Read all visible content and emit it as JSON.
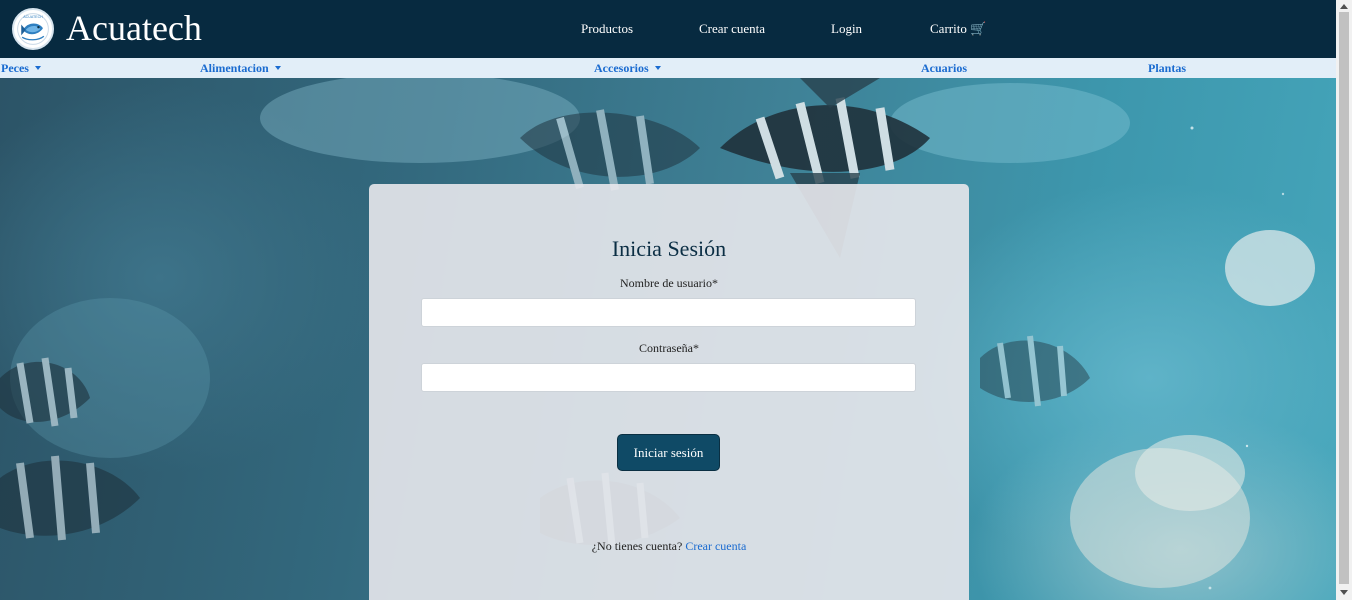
{
  "header": {
    "brand": "Acuatech",
    "logo_text": "ACUATECH",
    "nav": [
      {
        "label": "Productos"
      },
      {
        "label": "Crear cuenta"
      },
      {
        "label": "Login"
      },
      {
        "label": "Carrito 🛒"
      }
    ]
  },
  "categories": [
    {
      "label": "Peces",
      "dropdown": true
    },
    {
      "label": "Alimentacion",
      "dropdown": true
    },
    {
      "label": "Accesorios",
      "dropdown": true
    },
    {
      "label": "Acuarios",
      "dropdown": false
    },
    {
      "label": "Plantas",
      "dropdown": false
    }
  ],
  "login": {
    "title": "Inicia Sesión",
    "username_label": "Nombre de usuario*",
    "username_value": "",
    "password_label": "Contraseña*",
    "password_value": "",
    "submit_label": "Iniciar sesión",
    "signup_prompt": "¿No tienes cuenta?",
    "signup_link": "Crear cuenta"
  },
  "colors": {
    "header_bg": "#072a40",
    "category_bar_bg": "#e2eef8",
    "link": "#1a6bd0",
    "button_bg": "#0f4a66"
  }
}
